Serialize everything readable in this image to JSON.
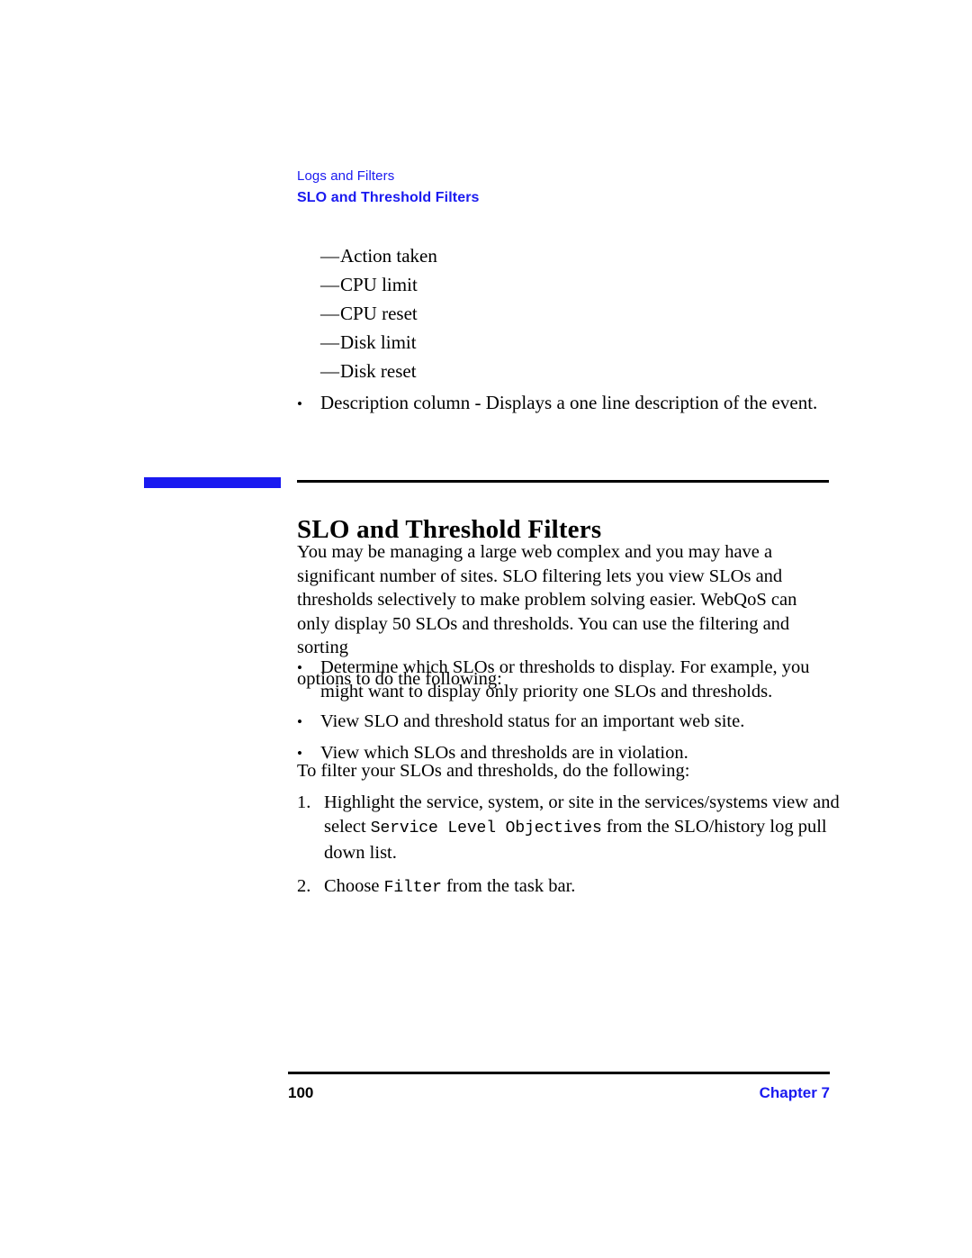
{
  "colors": {
    "accent_blue": "#1a1af0",
    "rule_black": "#000000",
    "page_background": "#ffffff",
    "body_text": "#000000"
  },
  "running_header": {
    "chapter_title": "Logs and Filters",
    "section_title": "SLO and Threshold Filters"
  },
  "continued_list": {
    "dash_items": [
      {
        "mark": "—",
        "label": "Action taken"
      },
      {
        "mark": "—",
        "label": "CPU limit"
      },
      {
        "mark": "—",
        "label": "CPU reset"
      },
      {
        "mark": "—",
        "label": "Disk limit"
      },
      {
        "mark": "—",
        "label": "Disk reset"
      }
    ],
    "bullet_mark": "•",
    "description_item": "Description column - Displays a one line description of the event."
  },
  "section": {
    "heading": "SLO and Threshold Filters",
    "intro_paragraph": "You may be managing a large web complex and you may have a significant number of sites. SLO filtering lets you view SLOs and thresholds selectively to make problem solving easier. WebQoS can only display 50 SLOs and thresholds. You can use the filtering and sorting",
    "intro_paragraph_tail": "options to do the following:",
    "bullet_mark": "•",
    "bullets": [
      "Determine which SLOs or thresholds to display. For example, you might want to display only priority one SLOs and thresholds.",
      "View SLO and threshold status for an important web site.",
      "View which SLOs and thresholds are in violation."
    ],
    "lead_in": "To filter your SLOs and thresholds, do the following:",
    "steps": [
      {
        "number": "1.",
        "text_before": "Highlight the service, system, or site in the services/systems view and select ",
        "code": "Service Level Objectives",
        "text_after": " from the SLO/history log pull down list."
      },
      {
        "number": "2.",
        "text_before": "Choose ",
        "code": "Filter",
        "text_after": " from the task bar."
      }
    ]
  },
  "footer": {
    "page_number": "100",
    "chapter_label": "Chapter 7"
  }
}
